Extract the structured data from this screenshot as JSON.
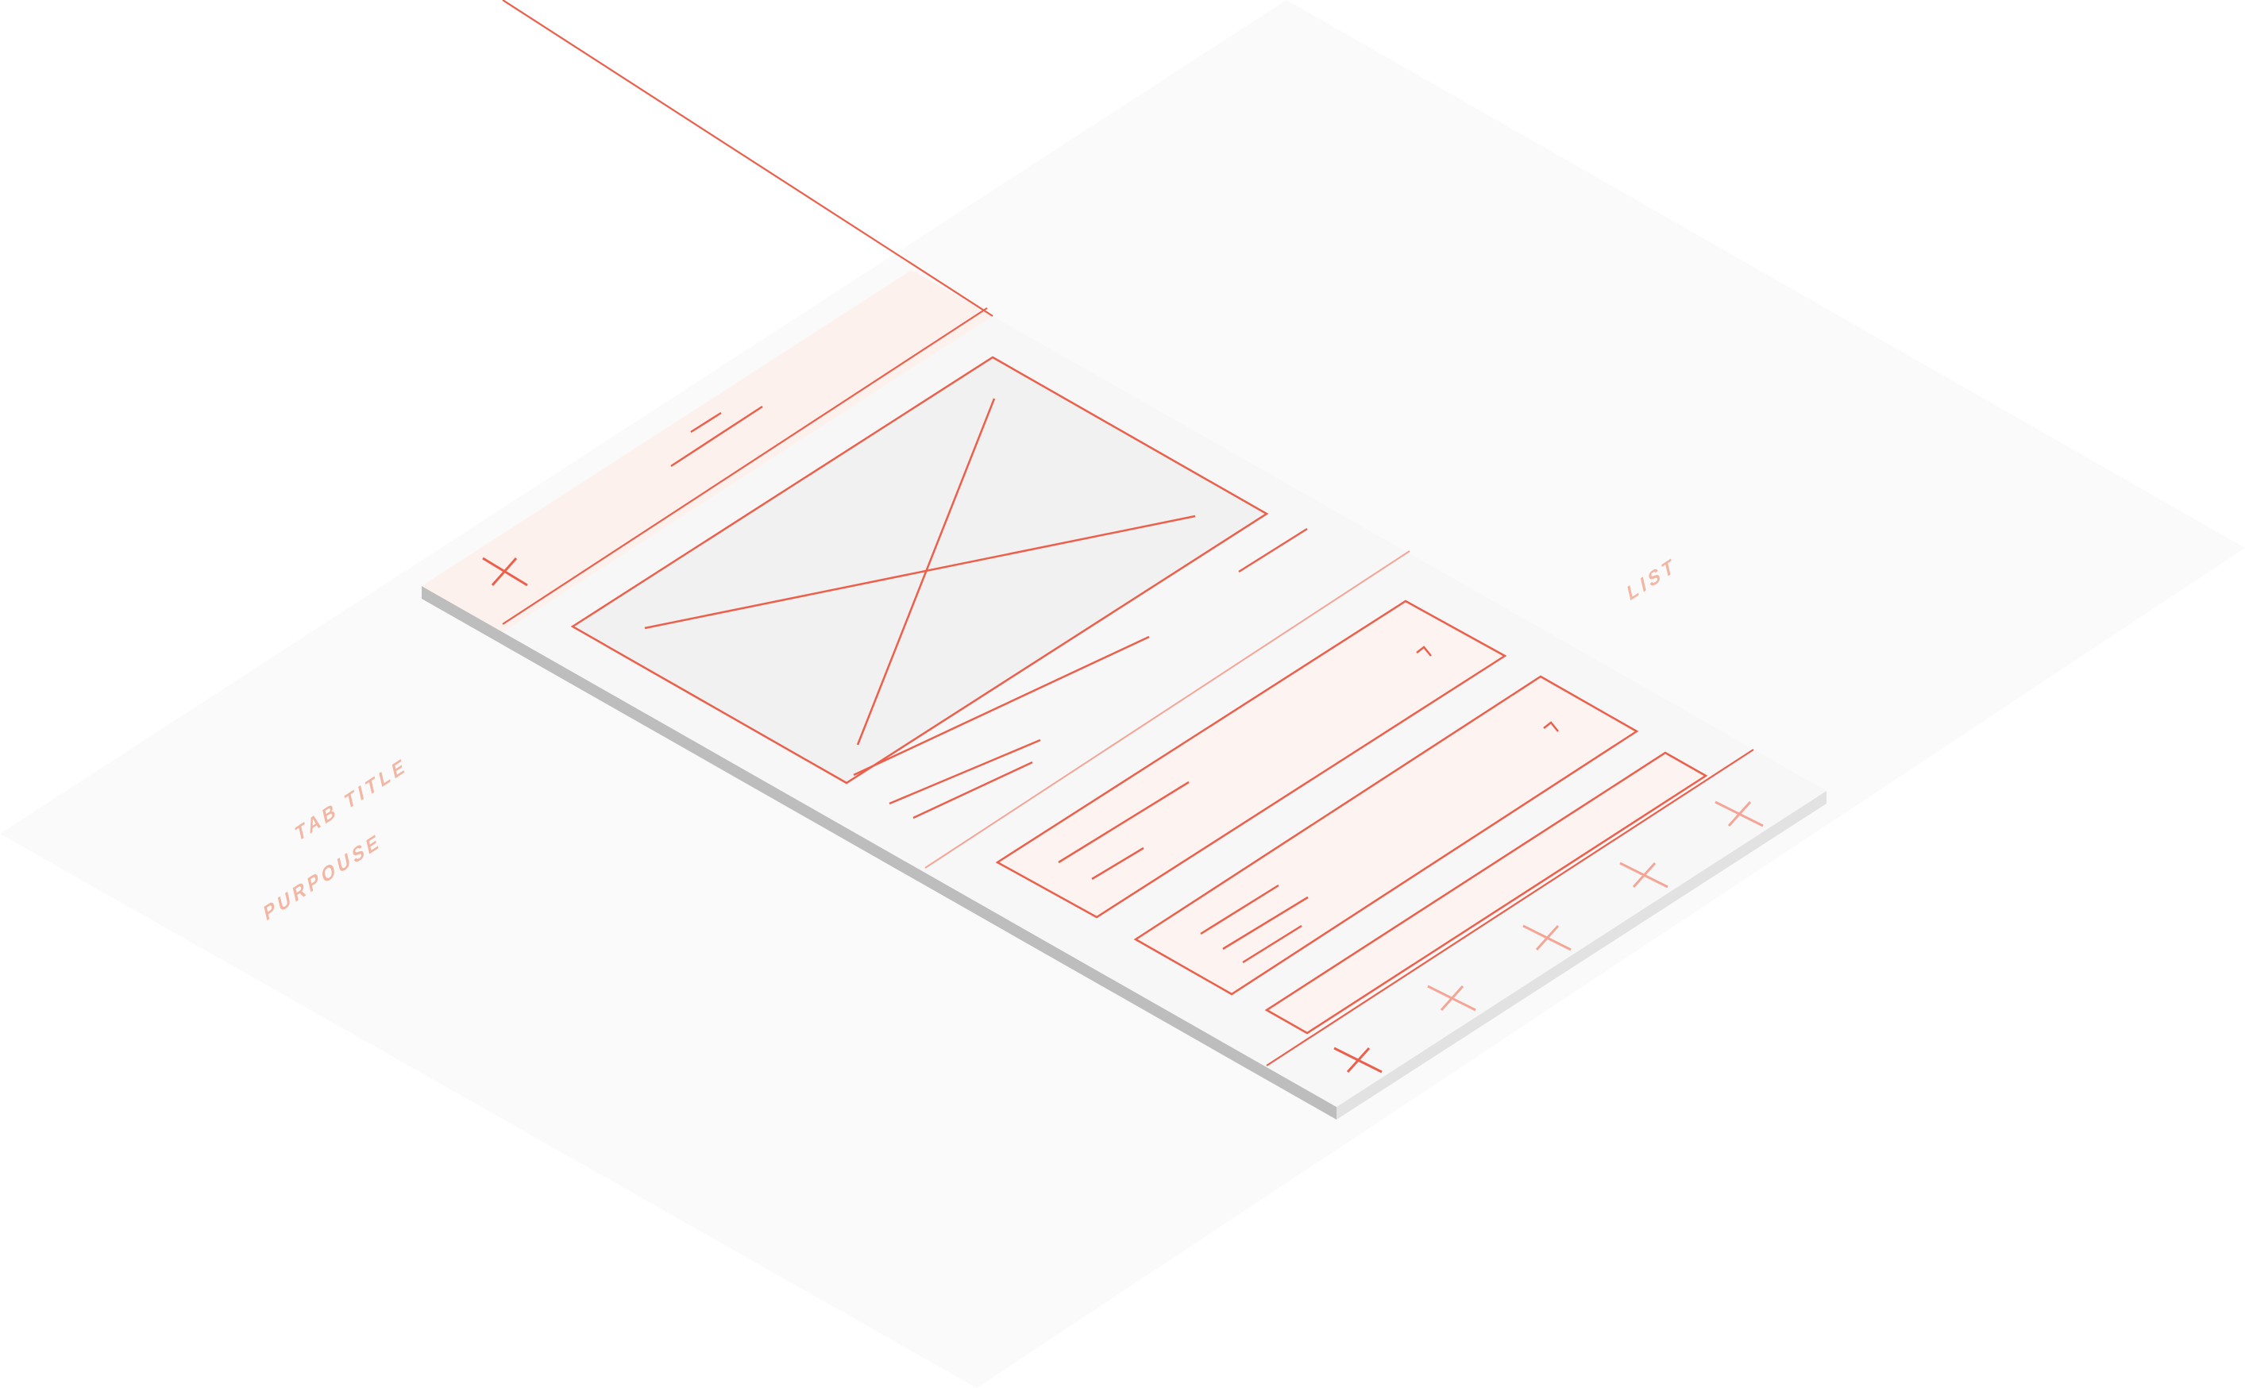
{
  "labels": {
    "tab_title": "TAB TITLE",
    "purpose": "PURPOUSE",
    "list": "LIST"
  },
  "colors": {
    "background": "#ffffff",
    "ground_plane": "#fafafa",
    "device_surface": "#f7f7f7",
    "device_edge": "#bdbdbd",
    "header_tint": "#fdf1ee",
    "wire_stroke": "#ec5f4b",
    "wire_stroke_faded": "#f4a596",
    "image_fill": "#f1f1f1",
    "label_text": "#f2b6a3"
  },
  "icons": {
    "close": "close-icon",
    "image_placeholder": "image-placeholder-icon",
    "chevron": "chevron-up-icon",
    "tab_bar": "tab-x-icon"
  },
  "list": {
    "item_count": 3
  },
  "tab_bar": {
    "tab_count": 5
  }
}
